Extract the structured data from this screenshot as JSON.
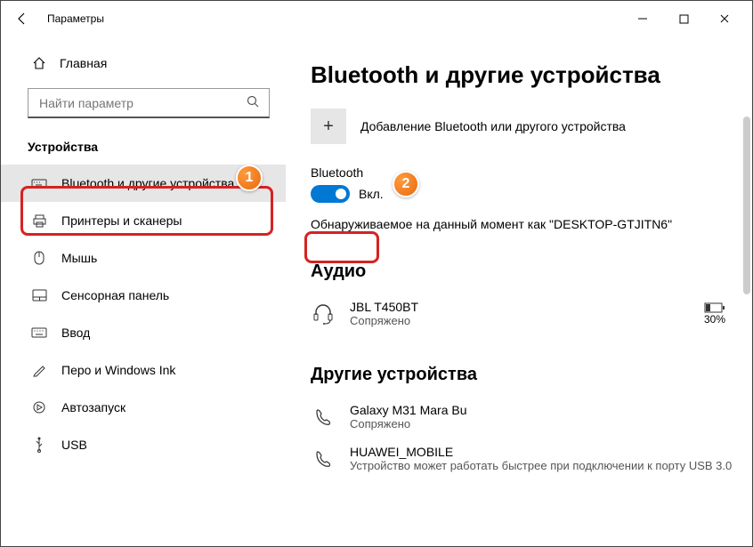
{
  "window": {
    "title": "Параметры"
  },
  "sidebar": {
    "home": "Главная",
    "search_placeholder": "Найти параметр",
    "section": "Устройства",
    "items": [
      {
        "label": "Bluetooth и другие устройства"
      },
      {
        "label": "Принтеры и сканеры"
      },
      {
        "label": "Мышь"
      },
      {
        "label": "Сенсорная панель"
      },
      {
        "label": "Ввод"
      },
      {
        "label": "Перо и Windows Ink"
      },
      {
        "label": "Автозапуск"
      },
      {
        "label": "USB"
      }
    ]
  },
  "content": {
    "title": "Bluetooth и другие устройства",
    "add_label": "Добавление Bluetooth или другого устройства",
    "bt_label": "Bluetooth",
    "toggle_state": "Вкл.",
    "discover_text": "Обнаруживаемое на данный момент как \"DESKTOP-GTJITN6\"",
    "audio_heading": "Аудио",
    "audio_device": {
      "name": "JBL T450BT",
      "status": "Сопряжено",
      "battery": "30%"
    },
    "other_heading": "Другие устройства",
    "other": [
      {
        "name": "Galaxy M31 Mara Bu",
        "status": "Сопряжено"
      },
      {
        "name": "HUAWEI_MOBILE",
        "status": "Устройство может работать быстрее при подключении к порту USB 3.0"
      }
    ]
  },
  "annotations": {
    "b1": "1",
    "b2": "2"
  }
}
